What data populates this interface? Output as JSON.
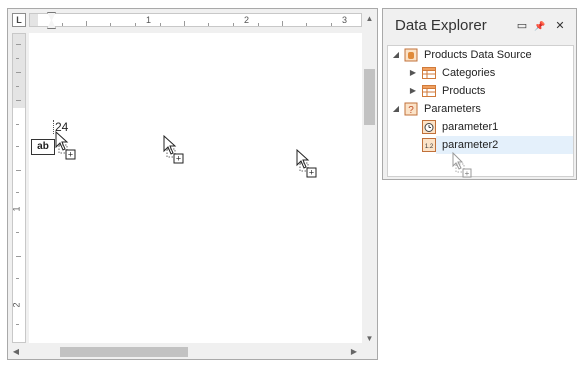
{
  "designer": {
    "corner_label": "L",
    "h_ruler_labels": [
      "1",
      "2",
      "3"
    ],
    "v_ruler_labels": [
      "1",
      "2"
    ],
    "dropped_text": "24",
    "control_label": "ab",
    "drag_symbol": "+"
  },
  "explorer": {
    "title": "Data Explorer",
    "buttons": {
      "maximize": "▭",
      "pin": "📌",
      "close": "✕"
    },
    "tree": {
      "data_source": {
        "label": "Products Data Source",
        "children": [
          {
            "label": "Categories"
          },
          {
            "label": "Products"
          }
        ]
      },
      "parameters": {
        "label": "Parameters",
        "children": [
          {
            "label": "parameter1",
            "type": "date-time",
            "icon_text": "◷"
          },
          {
            "label": "parameter2",
            "type": "float",
            "icon_text": "1.2"
          }
        ]
      }
    }
  },
  "colors": {
    "panel_bg": "#f0f0f0",
    "border": "#a9a9a9",
    "selection": "#e4f0fb",
    "table_icon": "#e67e22",
    "parameter_icon": "#d9822b"
  }
}
